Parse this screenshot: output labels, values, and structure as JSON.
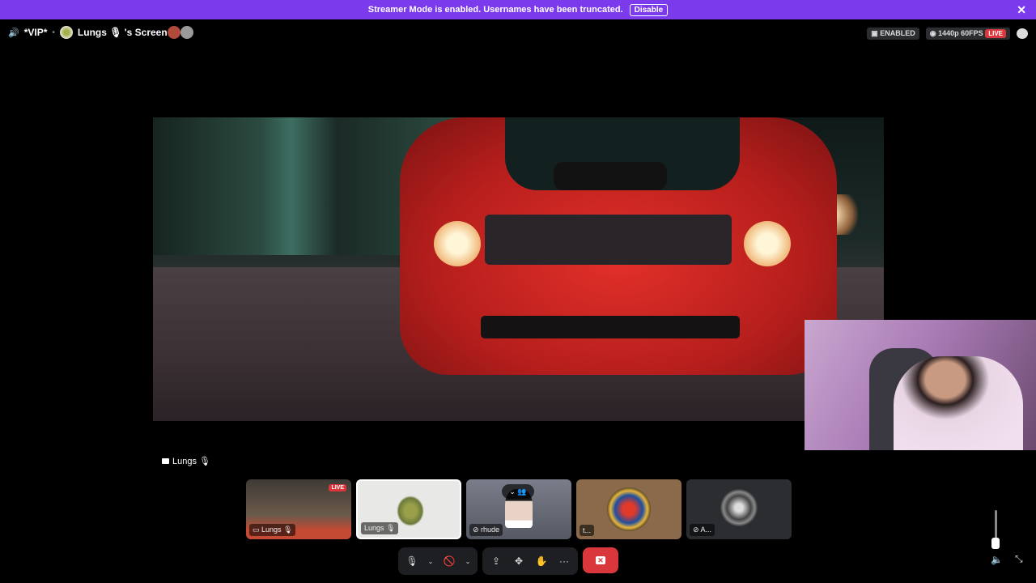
{
  "banner": {
    "message": "Streamer Mode is enabled. Usernames have been truncated.",
    "disable_label": "Disable",
    "close_glyph": "✕",
    "color": "#7c3aed"
  },
  "header": {
    "speaker_glyph": "🔊",
    "channel": "*VIP*",
    "separator": "•",
    "screen_title": "Lungs 🎙 's Screen",
    "enabled_label": "ENABLED",
    "quality_label": "1440p 60FPS",
    "live_label": "LIVE"
  },
  "stream": {
    "streamer_label": "Lungs 🎙"
  },
  "tiles": [
    {
      "label": "Lungs 🎙",
      "badge": "LIVE",
      "icon": "monitor-icon"
    },
    {
      "label": "Lungs 🎙",
      "icon": "lungs-image"
    },
    {
      "label": "rhude",
      "overlay": "⌄ 👥",
      "icon": "mic-muted-icon"
    },
    {
      "label": "t..."
    },
    {
      "label": "A...",
      "icon": "deafened-icon"
    }
  ],
  "controls": {
    "mic_glyph": "🎙",
    "caret": "⌄",
    "camera_glyph": "🚫",
    "share_glyph": "⇪",
    "activity_glyph": "✥",
    "soundboard_glyph": "✋",
    "more_glyph": "···",
    "end_glyph": "✕",
    "end_color": "#da373c"
  },
  "corner": {
    "volume_glyph": "🔈",
    "minimize_glyph": "⤡"
  }
}
